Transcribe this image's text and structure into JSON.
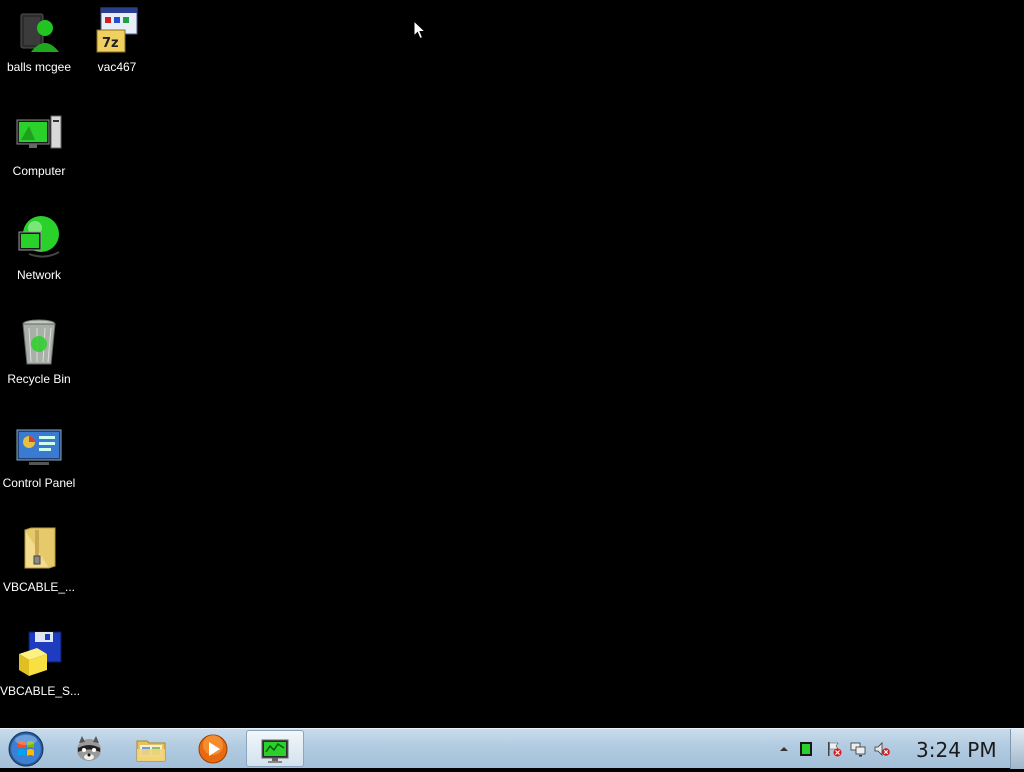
{
  "desktop": {
    "icons": [
      {
        "label": "balls mcgee",
        "icon": "user-folder-icon"
      },
      {
        "label": "vac467",
        "icon": "7z-installer-icon"
      },
      {
        "label": "Computer",
        "icon": "computer-icon"
      },
      {
        "label": "Network",
        "icon": "network-icon"
      },
      {
        "label": "Recycle Bin",
        "icon": "recycle-bin-icon"
      },
      {
        "label": "Control Panel",
        "icon": "control-panel-icon"
      },
      {
        "label": "VBCABLE_...",
        "icon": "zip-folder-icon"
      },
      {
        "label": "VBCABLE_S...",
        "icon": "setup-installer-icon"
      }
    ]
  },
  "taskbar": {
    "pinned": [
      {
        "icon": "raccoon-app-icon"
      },
      {
        "icon": "file-explorer-icon"
      },
      {
        "icon": "media-player-icon"
      },
      {
        "icon": "monitor-app-icon",
        "active": true
      }
    ],
    "tray": {
      "icons": [
        "show-hidden-icons-icon",
        "green-app-icon",
        "action-center-icon",
        "network-status-icon",
        "volume-muted-icon"
      ]
    },
    "clock": "3:24 PM"
  },
  "colors": {
    "desktop_bg": "#000000",
    "accent_green": "#2bd12b",
    "taskbar_bg": "#b2cbe1"
  }
}
